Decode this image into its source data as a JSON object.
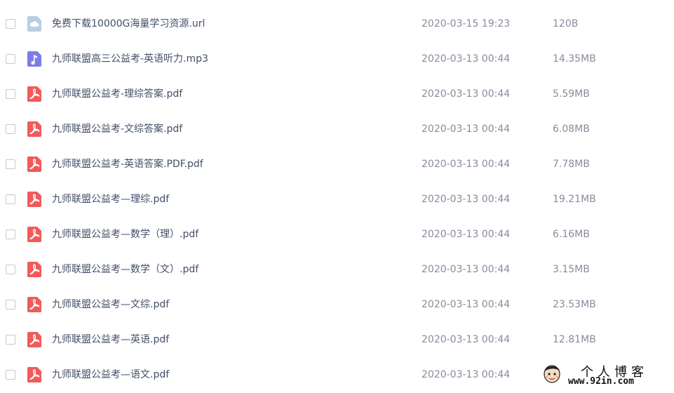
{
  "files": [
    {
      "name": "免费下载10000G海量学习资源.url",
      "date": "2020-03-15 19:23",
      "size": "120B",
      "icon": "cloud-link-icon"
    },
    {
      "name": "九师联盟高三公益考-英语听力.mp3",
      "date": "2020-03-13 00:44",
      "size": "14.35MB",
      "icon": "audio-file-icon"
    },
    {
      "name": "九师联盟公益考-理综答案.pdf",
      "date": "2020-03-13 00:44",
      "size": "5.59MB",
      "icon": "pdf-file-icon"
    },
    {
      "name": "九师联盟公益考-文综答案.pdf",
      "date": "2020-03-13 00:44",
      "size": "6.08MB",
      "icon": "pdf-file-icon"
    },
    {
      "name": "九师联盟公益考-英语答案.PDF.pdf",
      "date": "2020-03-13 00:44",
      "size": "7.78MB",
      "icon": "pdf-file-icon"
    },
    {
      "name": "九师联盟公益考—理综.pdf",
      "date": "2020-03-13 00:44",
      "size": "19.21MB",
      "icon": "pdf-file-icon"
    },
    {
      "name": "九师联盟公益考—数学（理）.pdf",
      "date": "2020-03-13 00:44",
      "size": "6.16MB",
      "icon": "pdf-file-icon"
    },
    {
      "name": "九师联盟公益考—数学（文）.pdf",
      "date": "2020-03-13 00:44",
      "size": "3.15MB",
      "icon": "pdf-file-icon"
    },
    {
      "name": "九师联盟公益考—文综.pdf",
      "date": "2020-03-13 00:44",
      "size": "23.53MB",
      "icon": "pdf-file-icon"
    },
    {
      "name": "九师联盟公益考—英语.pdf",
      "date": "2020-03-13 00:44",
      "size": "12.81MB",
      "icon": "pdf-file-icon"
    },
    {
      "name": "九师联盟公益考—语文.pdf",
      "date": "2020-03-13 00:44",
      "size": "",
      "icon": "pdf-file-icon"
    }
  ],
  "watermark": {
    "title": "个人博客",
    "url": "www.92in.com"
  },
  "colors": {
    "pdf": "#f25a5a",
    "audio": "#7a7de8",
    "cloud": "#b9cde3",
    "name_text": "#424e67",
    "meta_text": "#878c9c"
  }
}
